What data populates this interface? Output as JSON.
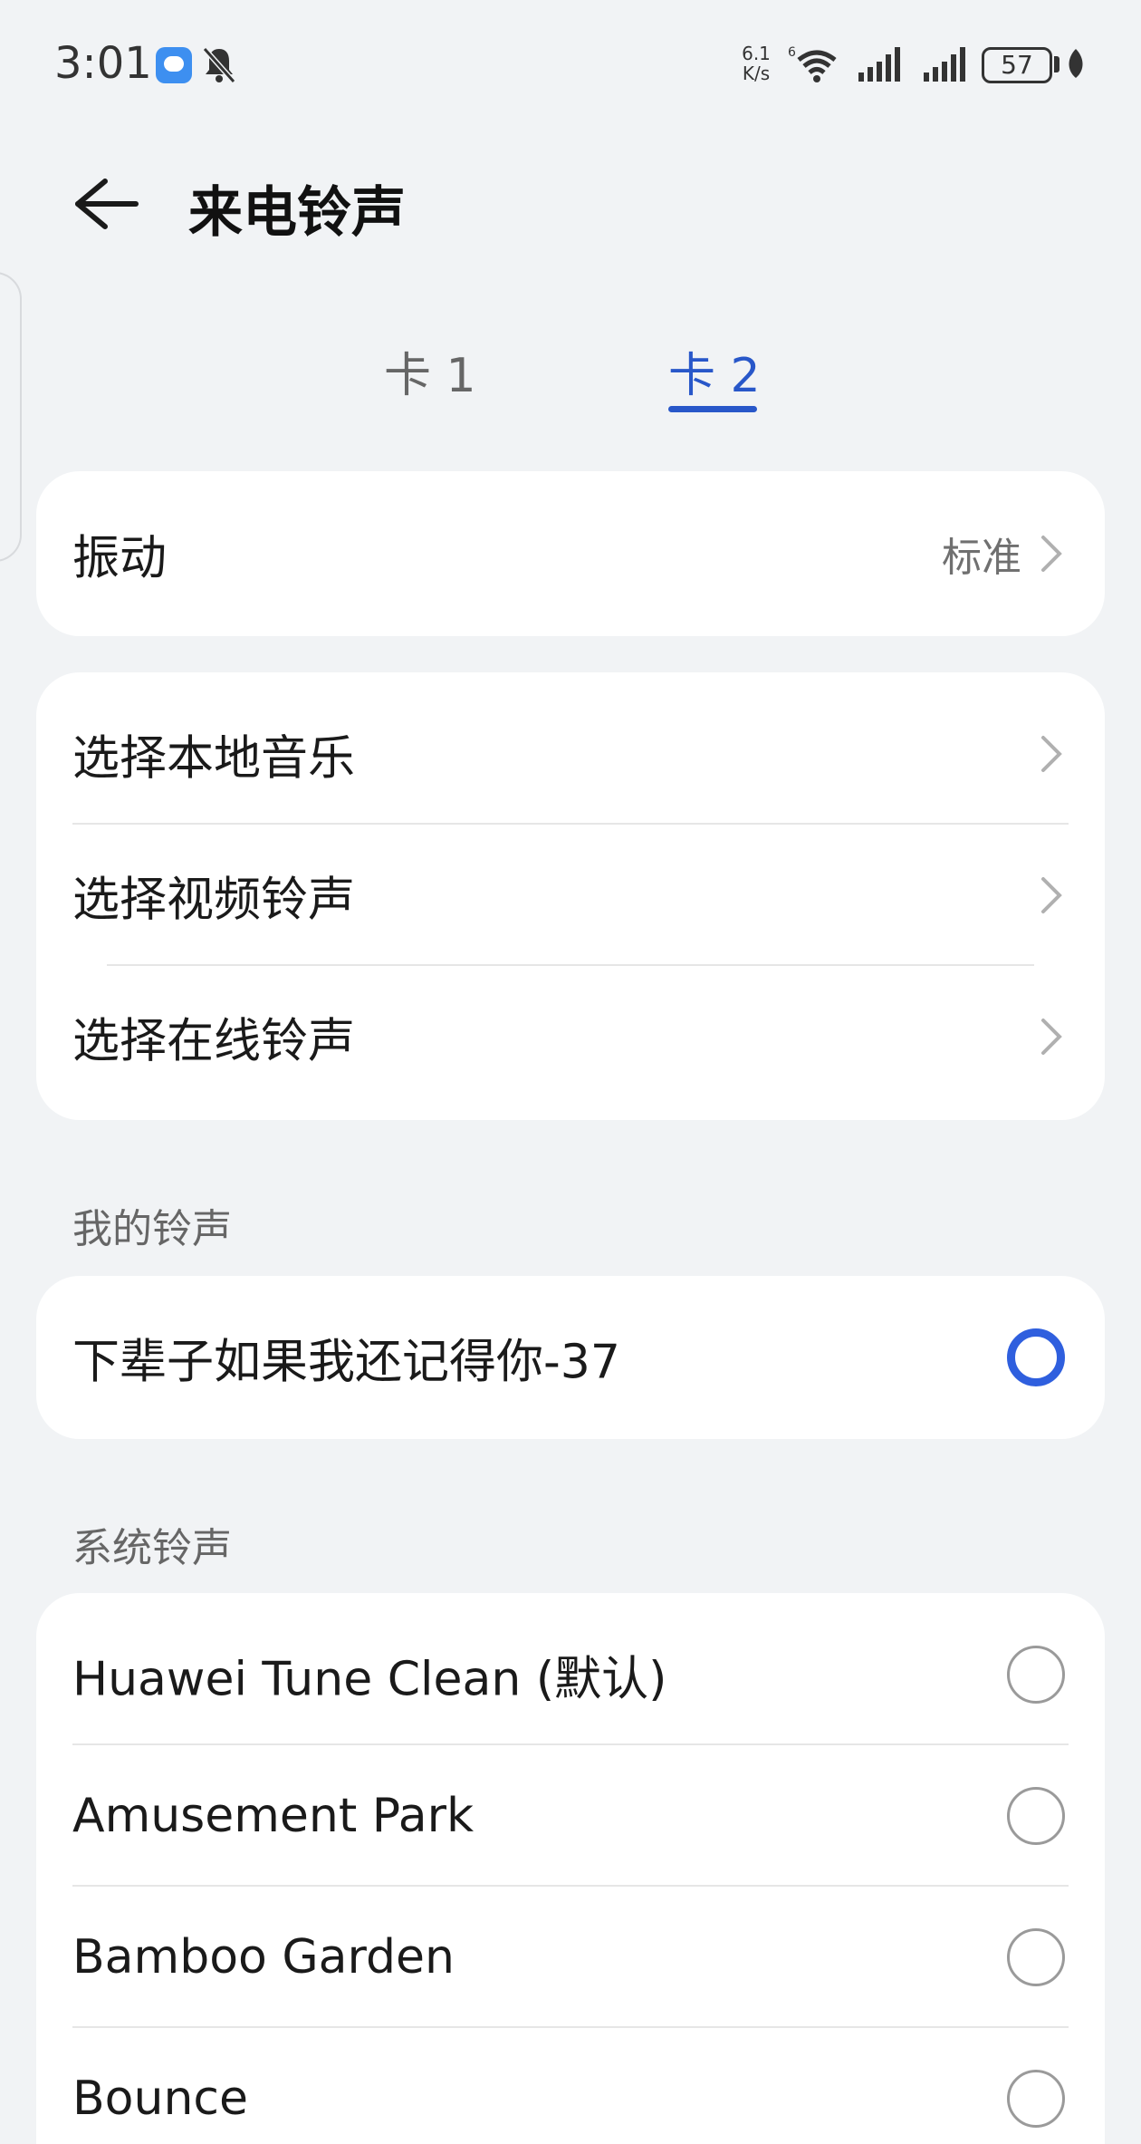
{
  "status_bar": {
    "time": "3:01",
    "net_speed_value": "6.1",
    "net_speed_unit": "K/s",
    "wifi_badge": "6",
    "battery": "57"
  },
  "header": {
    "title": "来电铃声"
  },
  "tabs": [
    {
      "label": "卡 1",
      "selected": false
    },
    {
      "label": "卡 2",
      "selected": true
    }
  ],
  "vibration": {
    "label": "振动",
    "value": "标准"
  },
  "choose_menu": [
    {
      "label": "选择本地音乐"
    },
    {
      "label": "选择视频铃声"
    },
    {
      "label": "选择在线铃声"
    }
  ],
  "my_ringtones": {
    "title": "我的铃声",
    "items": [
      {
        "label": "下辈子如果我还记得你-37",
        "selected": true
      }
    ]
  },
  "system_ringtones": {
    "title": "系统铃声",
    "items": [
      {
        "label": "Huawei Tune Clean (默认)",
        "selected": false
      },
      {
        "label": "Amusement Park",
        "selected": false
      },
      {
        "label": "Bamboo Garden",
        "selected": false
      },
      {
        "label": "Bounce",
        "selected": false
      }
    ]
  },
  "colors": {
    "accent": "#2f5fde",
    "background": "#f1f3f5",
    "card": "#ffffff"
  }
}
